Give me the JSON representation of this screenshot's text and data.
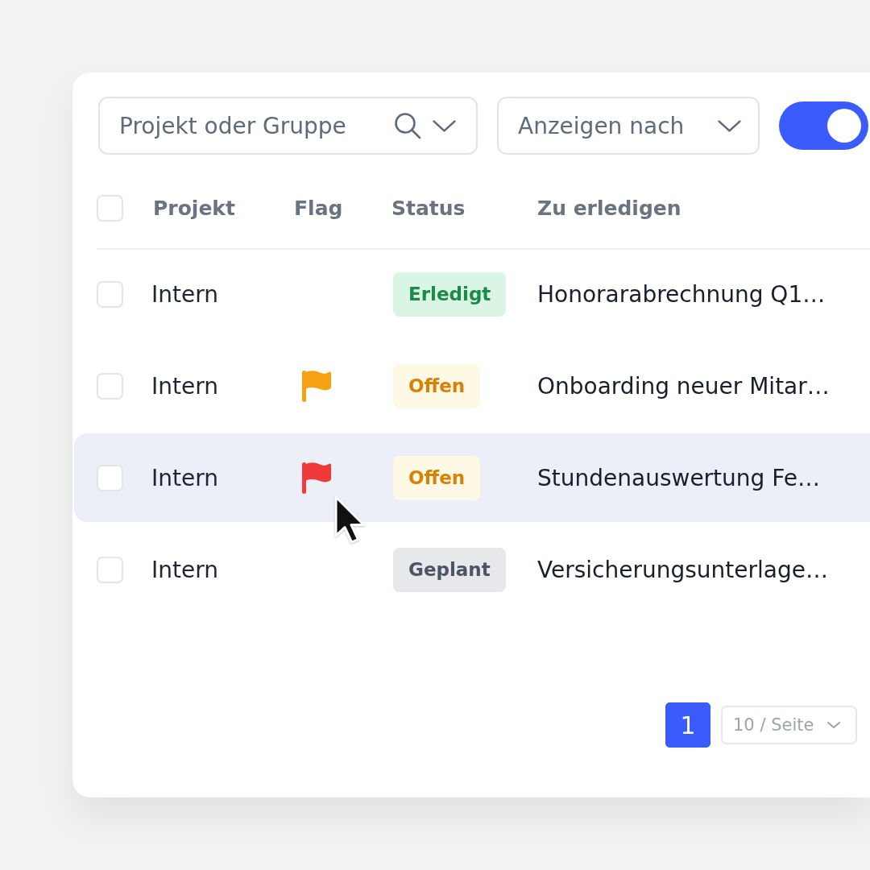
{
  "filters": {
    "search": {
      "placeholder": "Projekt oder Gruppe"
    },
    "view_select": {
      "placeholder": "Anzeigen nach"
    },
    "toggle": {
      "on": true
    }
  },
  "table": {
    "select_all": {
      "checked": false
    },
    "columns": [
      "Projekt",
      "Flag",
      "Status",
      "Zu erledigen"
    ],
    "rows": [
      {
        "checked": false,
        "hovered": false,
        "project": "Intern",
        "status": {
          "label": "Erledigt",
          "kind": "done"
        },
        "task": "Honorarabrechnung Q1…"
      },
      {
        "checked": false,
        "hovered": false,
        "project": "Intern",
        "flag": {
          "color": "#f6a111"
        },
        "status": {
          "label": "Offen",
          "kind": "open"
        },
        "task": "Onboarding neuer Mitar…"
      },
      {
        "checked": false,
        "hovered": true,
        "project": "Intern",
        "flag": {
          "color": "#f03a3a"
        },
        "status": {
          "label": "Offen",
          "kind": "open"
        },
        "task": "Stundenauswertung Fe…"
      },
      {
        "checked": false,
        "hovered": false,
        "project": "Intern",
        "status": {
          "label": "Geplant",
          "kind": "planned"
        },
        "task": "Versicherungsunterlage…"
      }
    ]
  },
  "pagination": {
    "pages": [
      {
        "label": "1",
        "selected": true
      }
    ],
    "page_size": "10 / Seite"
  }
}
